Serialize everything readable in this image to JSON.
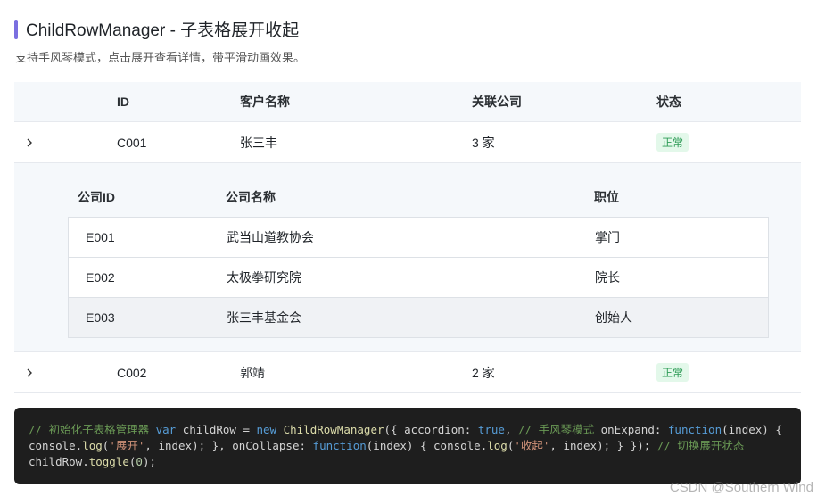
{
  "header": {
    "title": "ChildRowManager - 子表格展开收起",
    "subtitle": "支持手风琴模式，点击展开查看详情，带平滑动画效果。"
  },
  "table": {
    "columns": [
      "ID",
      "客户名称",
      "关联公司",
      "状态"
    ],
    "rows": [
      {
        "id": "C001",
        "name": "张三丰",
        "companies": "3 家",
        "status": "正常"
      },
      {
        "id": "C002",
        "name": "郭靖",
        "companies": "2 家",
        "status": "正常"
      }
    ]
  },
  "subtable": {
    "columns": [
      "公司ID",
      "公司名称",
      "职位"
    ],
    "rows": [
      {
        "id": "E001",
        "name": "武当山道教协会",
        "position": "掌门"
      },
      {
        "id": "E002",
        "name": "太极拳研究院",
        "position": "院长"
      },
      {
        "id": "E003",
        "name": "张三丰基金会",
        "position": "创始人"
      }
    ]
  },
  "code": {
    "comment1": "// 初始化子表格管理器",
    "comment2": "// 手风琴模式",
    "comment3": "// 切换展开状态",
    "str1": "'展开'",
    "str2": "'收起'"
  },
  "watermark": "CSDN @Southern Wind",
  "colors": {
    "accent": "#7b6fe0",
    "badge_bg": "#e3f8ea",
    "badge_text": "#2e9c57"
  }
}
